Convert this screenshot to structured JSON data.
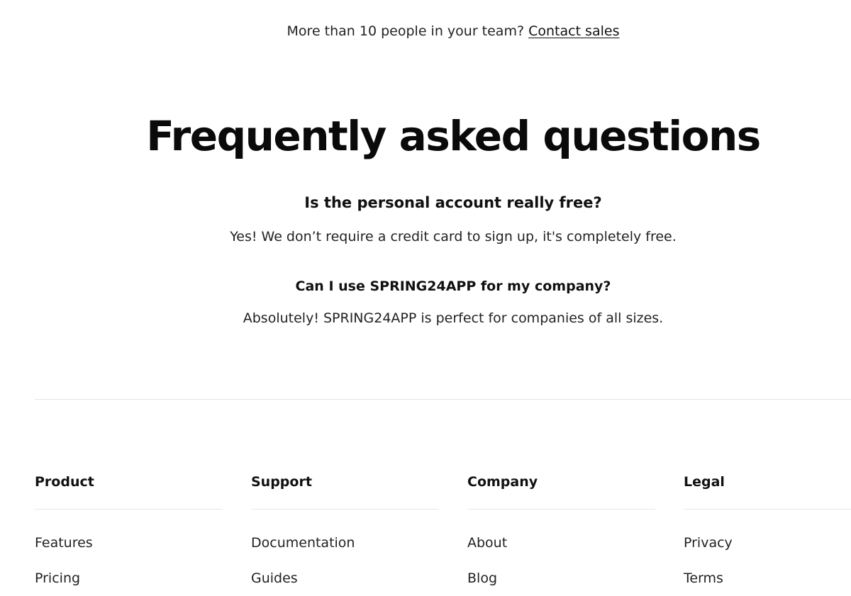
{
  "team_note": {
    "text": "More than 10 people in your team? ",
    "link_label": "Contact sales"
  },
  "faq": {
    "title": "Frequently asked questions",
    "items": [
      {
        "question": "Is the personal account really free?",
        "answer": "Yes! We don’t require a credit card to sign up, it's completely free."
      },
      {
        "question": "Can I use SPRING24APP for my company?",
        "answer": "Absolutely! SPRING24APP is perfect for companies of all sizes."
      }
    ]
  },
  "footer": {
    "columns": [
      {
        "heading": "Product",
        "links": [
          "Features",
          "Pricing"
        ]
      },
      {
        "heading": "Support",
        "links": [
          "Documentation",
          "Guides"
        ]
      },
      {
        "heading": "Company",
        "links": [
          "About",
          "Blog"
        ]
      },
      {
        "heading": "Legal",
        "links": [
          "Privacy",
          "Terms"
        ]
      }
    ]
  }
}
